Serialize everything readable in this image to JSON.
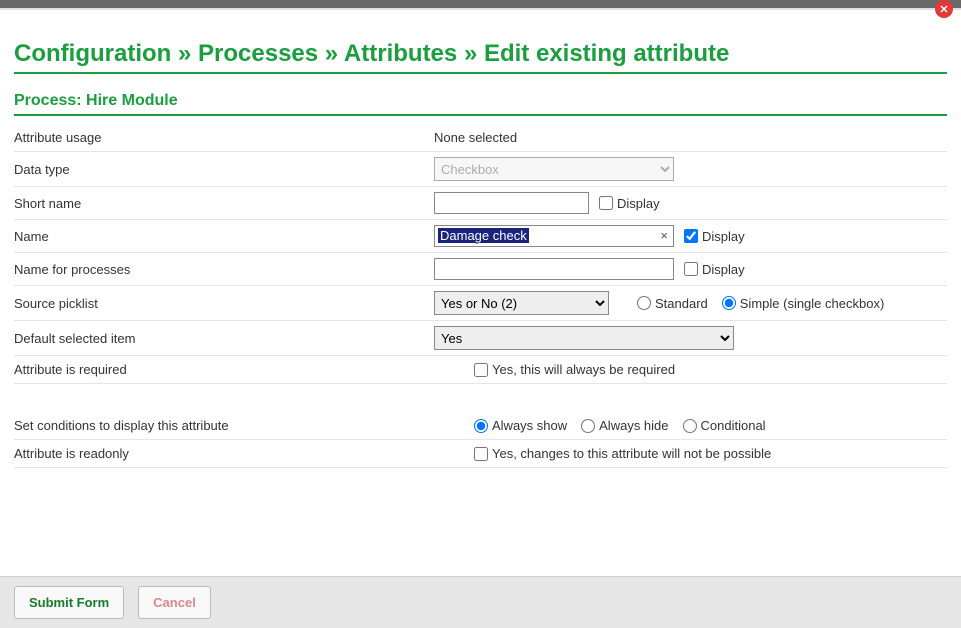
{
  "header": {
    "close_icon": "close"
  },
  "breadcrumb": {
    "part1": "Configuration",
    "sep": "»",
    "part2": "Processes",
    "part3": "Attributes",
    "part4": "Edit existing attribute"
  },
  "process": {
    "label": "Process: Hire Module"
  },
  "rows": {
    "attribute_usage": {
      "label": "Attribute usage",
      "value": "None selected"
    },
    "data_type": {
      "label": "Data type",
      "value": "Checkbox"
    },
    "short_name": {
      "label": "Short name",
      "value": "",
      "display_label": "Display",
      "display_checked": false
    },
    "name": {
      "label": "Name",
      "value": "Damage check",
      "display_label": "Display",
      "display_checked": true
    },
    "name_for_processes": {
      "label": "Name for processes",
      "value": "",
      "display_label": "Display",
      "display_checked": false
    },
    "source_picklist": {
      "label": "Source picklist",
      "value": "Yes or No (2)",
      "radio_standard": "Standard",
      "radio_simple": "Simple (single checkbox)",
      "selected": "simple"
    },
    "default_selected_item": {
      "label": "Default selected item",
      "value": "Yes"
    },
    "attribute_required": {
      "label": "Attribute is required",
      "chk_label": "Yes, this will always be required",
      "checked": false
    },
    "display_conditions": {
      "label": "Set conditions to display this attribute",
      "opt_always_show": "Always show",
      "opt_always_hide": "Always hide",
      "opt_conditional": "Conditional",
      "selected": "always_show"
    },
    "readonly": {
      "label": "Attribute is readonly",
      "chk_label": "Yes, changes to this attribute will not be possible",
      "checked": false
    }
  },
  "footer": {
    "submit": "Submit Form",
    "cancel": "Cancel"
  }
}
